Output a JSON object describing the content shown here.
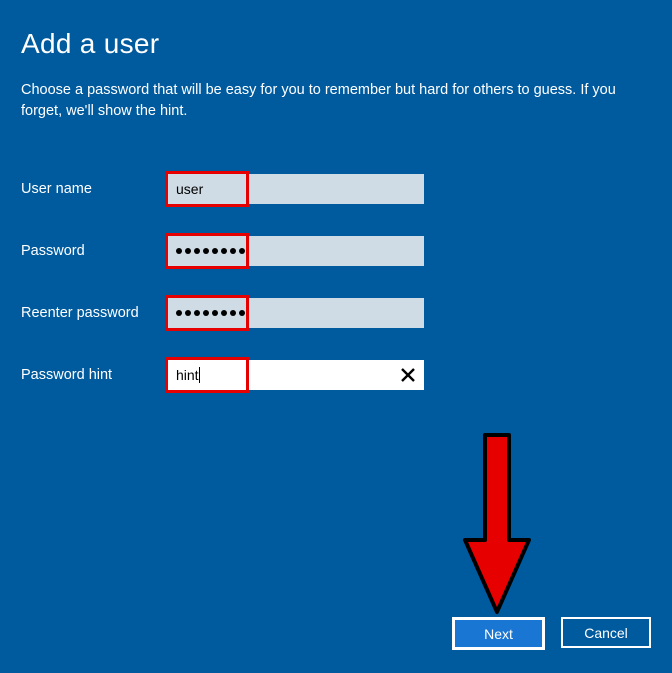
{
  "title": "Add a user",
  "description": "Choose a password that will be easy for you to remember but hard for others to guess. If you forget, we'll show the hint.",
  "form": {
    "username": {
      "label": "User name",
      "value": "user"
    },
    "password": {
      "label": "Password",
      "value": "••••••••",
      "dotcount": 8
    },
    "reenter": {
      "label": "Reenter password",
      "value": "••••••••",
      "dotcount": 8
    },
    "hint": {
      "label": "Password hint",
      "value": "hint"
    }
  },
  "buttons": {
    "next": "Next",
    "cancel": "Cancel"
  }
}
